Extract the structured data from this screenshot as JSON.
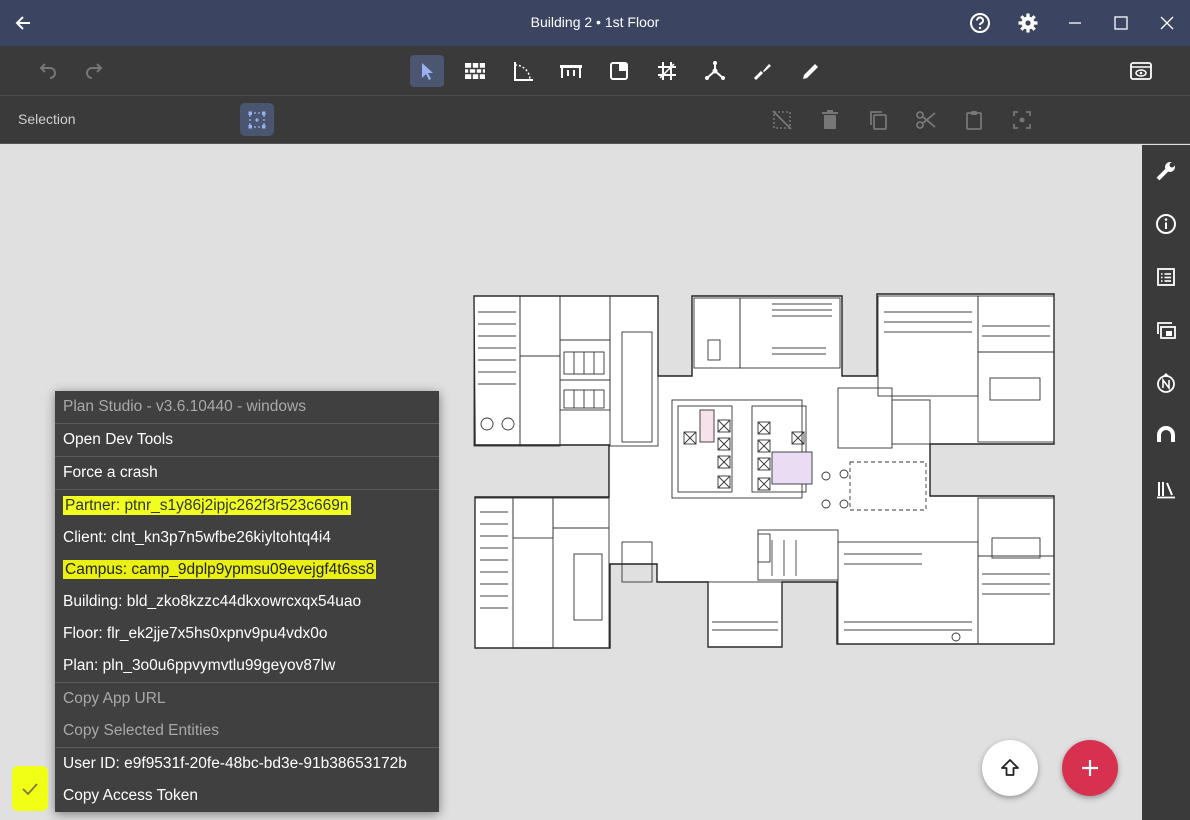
{
  "window": {
    "title": "Building 2 • 1st Floor",
    "icons": [
      "back-arrow-icon",
      "help-icon",
      "settings-gear-icon",
      "minimize-icon",
      "maximize-icon",
      "close-icon"
    ]
  },
  "toolbar": {
    "undo_icon": "undo-icon",
    "redo_icon": "redo-icon",
    "tools": [
      "select-tool",
      "wall-tool",
      "room-tool",
      "furniture-tool",
      "area-tool",
      "grid-tool",
      "network-tool",
      "brush-tool",
      "pencil-tool"
    ],
    "active_tool": "select-tool",
    "view_icon": "layers-view-icon"
  },
  "subbar": {
    "mode_label": "Selection",
    "actions": [
      "deselect-icon",
      "delete-icon",
      "copy-icon",
      "cut-icon",
      "paste-icon",
      "focus-icon"
    ]
  },
  "rightbar": {
    "icons": [
      "wrench-icon",
      "info-icon",
      "list-icon",
      "layers-icon",
      "north-icon",
      "magnet-icon",
      "library-icon"
    ]
  },
  "dev_menu": {
    "header": "Plan Studio - v3.6.10440 - windows",
    "open_dev_tools": "Open Dev Tools",
    "force_crash": "Force a crash",
    "partner": "Partner: ptnr_s1y86j2ipjc262f3r523c669n",
    "client": "Client: clnt_kn3p7n5wfbe26kiyltohtq4i4",
    "campus": "Campus: camp_9dplp9ypmsu09evejgf4t6ss8",
    "building": "Building: bld_zko8kzzc44dkxowrcxqx54uao",
    "floor": "Floor: flr_ek2jje7x5hs0xpnv9pu4vdx0o",
    "plan": "Plan: pln_3o0u6ppvymvtlu99geyov87lw",
    "copy_app_url": "Copy App URL",
    "copy_selected": "Copy Selected Entities",
    "user_id": "User ID: e9f9531f-20fe-48bc-bd3e-91b38653172b",
    "copy_token": "Copy Access Token"
  },
  "colors": {
    "titlebar": "#3b4460",
    "toolbar": "#3a3a3a",
    "canvas": "#e0e0e0",
    "highlight": "#f0ff20",
    "fab_red": "#d7314f"
  }
}
